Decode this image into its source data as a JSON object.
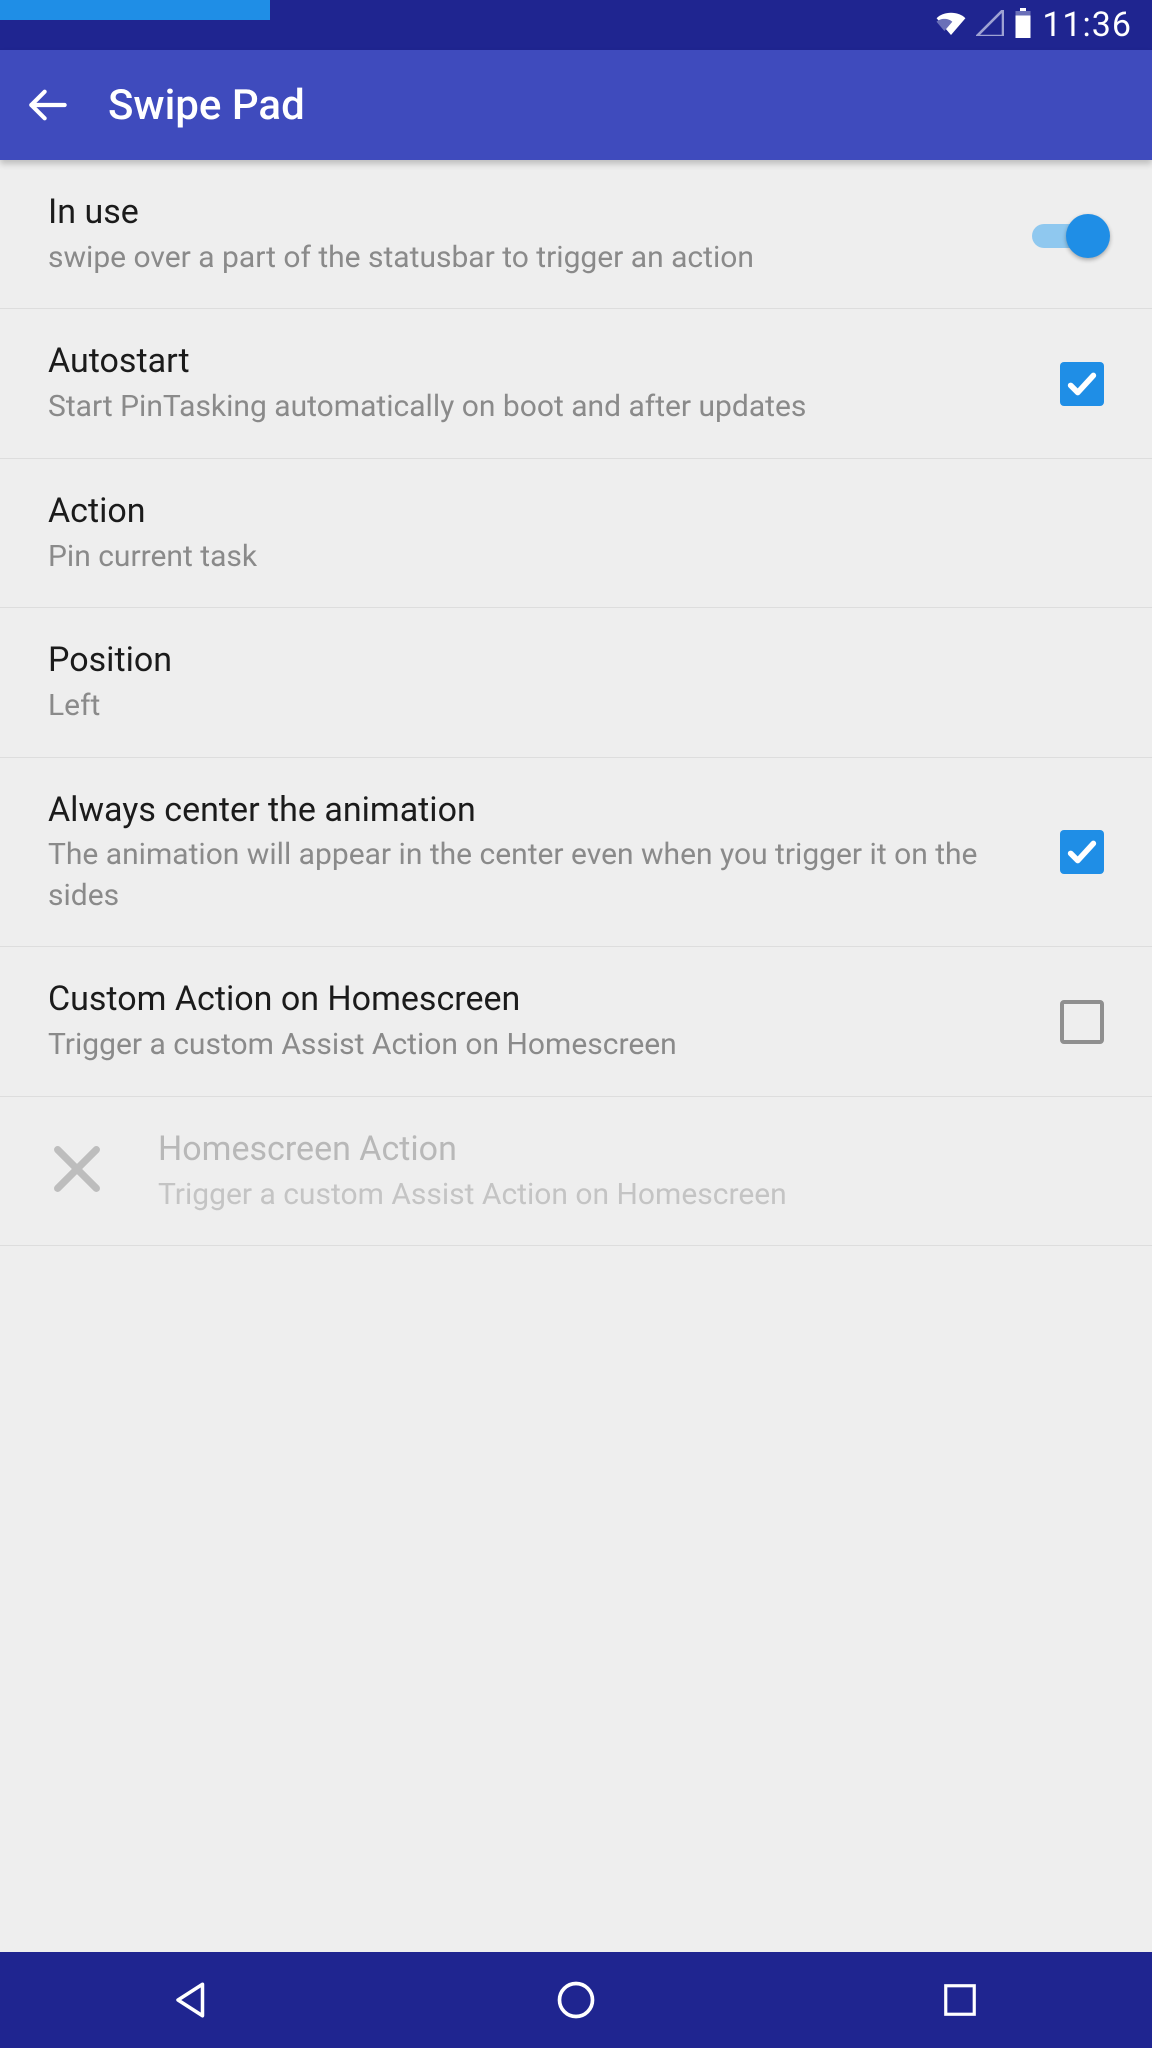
{
  "statusbar": {
    "time": "11:36"
  },
  "appbar": {
    "title": "Swipe Pad"
  },
  "rows": {
    "in_use": {
      "title": "In use",
      "sub": "swipe over a part of the statusbar to trigger an action",
      "switch_on": true
    },
    "autostart": {
      "title": "Autostart",
      "sub": "Start PinTasking automatically on boot and after updates",
      "checked": true
    },
    "action": {
      "title": "Action",
      "sub": "Pin current task"
    },
    "position": {
      "title": "Position",
      "sub": "Left"
    },
    "center_anim": {
      "title": "Always center the animation",
      "sub": "The animation will appear in the center even when you trigger it on the sides",
      "checked": true
    },
    "custom_action": {
      "title": "Custom Action on Homescreen",
      "sub": "Trigger a custom Assist Action on Homescreen",
      "checked": false
    },
    "home_action": {
      "title": "Homescreen Action",
      "sub": "Trigger a custom Assist Action on Homescreen"
    }
  }
}
